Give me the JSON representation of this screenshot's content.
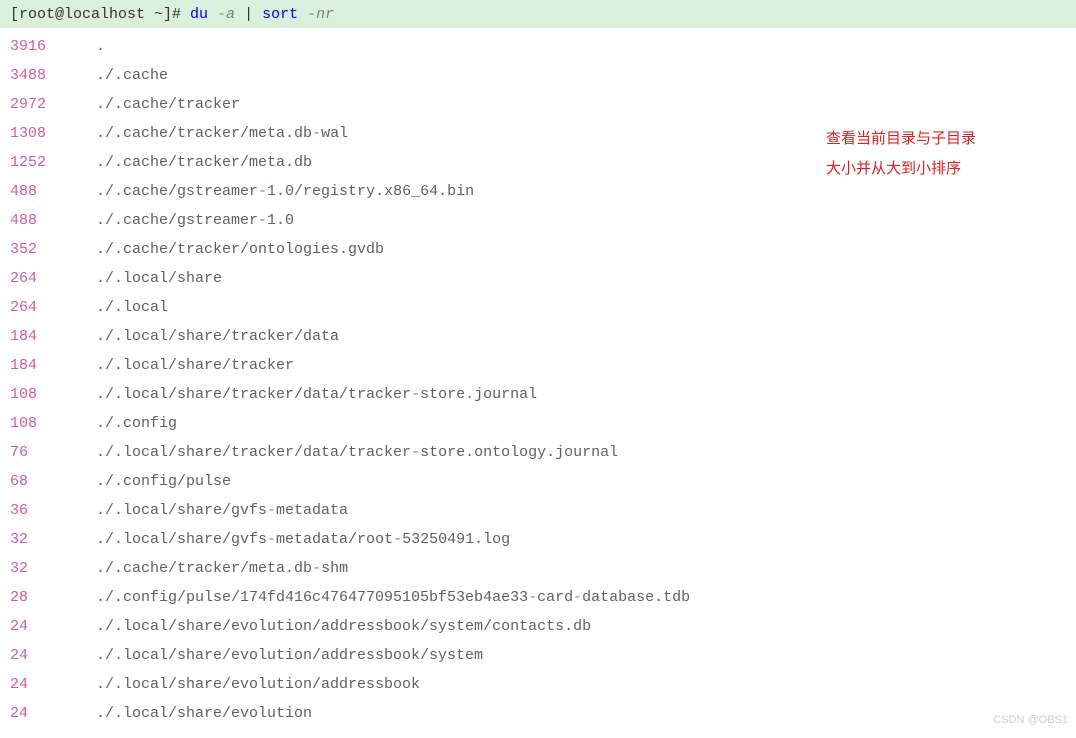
{
  "prompt": {
    "userhost": "[root@localhost ~]# ",
    "cmd1": "du",
    "opt1": " -a ",
    "pipe": "| ",
    "cmd2": "sort",
    "opt2": " -nr"
  },
  "rows": [
    {
      "size": "3916",
      "path": "."
    },
    {
      "size": "3488",
      "path": "./.cache"
    },
    {
      "size": "2972",
      "path": "./.cache/tracker"
    },
    {
      "size": "1308",
      "path": "./.cache/tracker/meta.db-wal"
    },
    {
      "size": "1252",
      "path": "./.cache/tracker/meta.db"
    },
    {
      "size": "488",
      "path": "./.cache/gstreamer-1.0/registry.x86_64.bin"
    },
    {
      "size": "488",
      "path": "./.cache/gstreamer-1.0"
    },
    {
      "size": "352",
      "path": "./.cache/tracker/ontologies.gvdb"
    },
    {
      "size": "264",
      "path": "./.local/share"
    },
    {
      "size": "264",
      "path": "./.local"
    },
    {
      "size": "184",
      "path": "./.local/share/tracker/data"
    },
    {
      "size": "184",
      "path": "./.local/share/tracker"
    },
    {
      "size": "108",
      "path": "./.local/share/tracker/data/tracker-store.journal"
    },
    {
      "size": "108",
      "path": "./.config"
    },
    {
      "size": "76",
      "path": "./.local/share/tracker/data/tracker-store.ontology.journal"
    },
    {
      "size": "68",
      "path": "./.config/pulse"
    },
    {
      "size": "36",
      "path": "./.local/share/gvfs-metadata"
    },
    {
      "size": "32",
      "path": "./.local/share/gvfs-metadata/root-53250491.log"
    },
    {
      "size": "32",
      "path": "./.cache/tracker/meta.db-shm"
    },
    {
      "size": "28",
      "path": "./.config/pulse/174fd416c476477095105bf53eb4ae33-card-database.tdb"
    },
    {
      "size": "24",
      "path": "./.local/share/evolution/addressbook/system/contacts.db"
    },
    {
      "size": "24",
      "path": "./.local/share/evolution/addressbook/system"
    },
    {
      "size": "24",
      "path": "./.local/share/evolution/addressbook"
    },
    {
      "size": "24",
      "path": "./.local/share/evolution"
    }
  ],
  "annotation": {
    "line1": "查看当前目录与子目录",
    "line2": "大小并从大到小排序"
  },
  "watermark": "CSDN @OBS1"
}
